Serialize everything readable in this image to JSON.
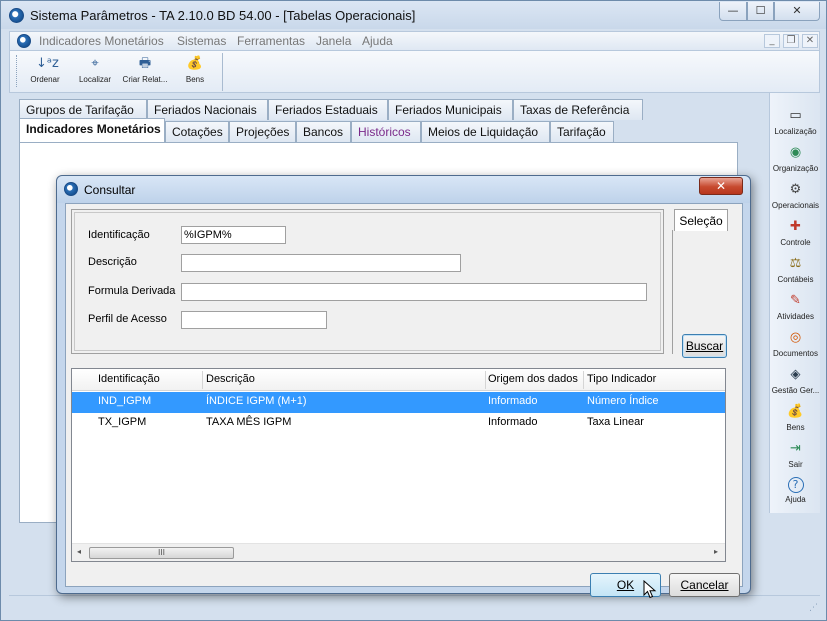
{
  "window": {
    "title": "Sistema Parâmetros -  TA 2.10.0 BD 54.00 - [Tabelas Operacionais]",
    "controls": {
      "minimize": "—",
      "maximize": "☐",
      "close": "✕"
    }
  },
  "menubar": {
    "items": [
      "Indicadores Monetários",
      "Sistemas",
      "Ferramentas",
      "Janela",
      "Ajuda"
    ],
    "mdi_controls": {
      "minimize": "_",
      "restore": "❐",
      "close": "✕"
    }
  },
  "toolbar": {
    "buttons": [
      {
        "label": "Ordenar",
        "icon": "sort-az-icon",
        "glyph": "↓ᵃz"
      },
      {
        "label": "Localizar",
        "icon": "find-icon",
        "glyph": "⌖"
      },
      {
        "label": "Criar Relat...",
        "icon": "report-icon",
        "glyph": "🖶"
      },
      {
        "label": "Bens",
        "icon": "money-bag-icon",
        "glyph": "💰"
      }
    ]
  },
  "tabs": {
    "row1": [
      "Grupos de Tarifação",
      "Feriados Nacionais",
      "Feriados Estaduais",
      "Feriados Municipais",
      "Taxas de Referência"
    ],
    "row2": [
      "Indicadores Monetários",
      "Cotações",
      "Projeções",
      "Bancos",
      "Históricos",
      "Meios de Liquidação",
      "Tarifação"
    ],
    "active": "Indicadores Monetários"
  },
  "right_panel": {
    "items": [
      {
        "label": "Localização",
        "icon": "location-icon",
        "glyph": "▭",
        "color": "#333333"
      },
      {
        "label": "Organização",
        "icon": "organization-icon",
        "glyph": "◉",
        "color": "#2e8b57"
      },
      {
        "label": "Operacionais",
        "icon": "operations-icon",
        "glyph": "⚙",
        "color": "#444444"
      },
      {
        "label": "Controle",
        "icon": "control-icon",
        "glyph": "✚",
        "color": "#c0392b"
      },
      {
        "label": "Contábeis",
        "icon": "scale-icon",
        "glyph": "⚖",
        "color": "#8a6d1a"
      },
      {
        "label": "Atividades",
        "icon": "activities-icon",
        "glyph": "✎",
        "color": "#c0392b"
      },
      {
        "label": "Documentos",
        "icon": "documents-icon",
        "glyph": "◎",
        "color": "#d35400"
      },
      {
        "label": "Gestão Ger...",
        "icon": "management-icon",
        "glyph": "◈",
        "color": "#2c3e50"
      },
      {
        "label": "Bens",
        "icon": "money-bag-icon",
        "glyph": "💰",
        "color": "#2e8b57"
      },
      {
        "label": "Sair",
        "icon": "exit-icon",
        "glyph": "⇥",
        "color": "#2e8b57"
      },
      {
        "label": "Ajuda",
        "icon": "help-icon",
        "glyph": "?",
        "color": "#2b6fb6"
      }
    ]
  },
  "dialog": {
    "title": "Consultar",
    "close": "✕",
    "fields": [
      {
        "label": "Identificação",
        "value": "%IGPM%"
      },
      {
        "label": "Descrição",
        "value": ""
      },
      {
        "label": "Formula Derivada",
        "value": ""
      },
      {
        "label": "Perfil de Acesso",
        "value": ""
      }
    ],
    "side_tab": "Seleção",
    "search_button": "Buscar",
    "grid": {
      "columns": [
        "Identificação",
        "Descrição",
        "Origem dos dados",
        "Tipo Indicador"
      ],
      "rows": [
        {
          "cells": [
            "IND_IGPM",
            "ÍNDICE IGPM (M+1)",
            "Informado",
            "Número Índice"
          ],
          "selected": true
        },
        {
          "cells": [
            "TX_IGPM",
            "TAXA MÊS IGPM",
            "Informado",
            "Taxa Linear"
          ],
          "selected": false
        }
      ],
      "scroll_left": "◂",
      "scroll_right": "▸",
      "scroll_thumb": "III"
    },
    "ok_button": "OK",
    "cancel_button": "Cancelar"
  },
  "status": {
    "grip": "⋰"
  }
}
